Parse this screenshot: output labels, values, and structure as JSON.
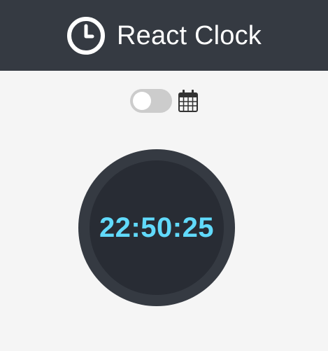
{
  "header": {
    "title": "React Clock",
    "icon": "clock-icon"
  },
  "controls": {
    "toggle_on": false,
    "calendar_icon": "calendar-icon"
  },
  "clock": {
    "time": "22:50:25"
  },
  "colors": {
    "header_bg": "#353a42",
    "page_bg": "#f5f5f5",
    "clock_ring": "#353a42",
    "clock_inner": "#282c34",
    "time_text": "#61dafb",
    "toggle_off": "#cccccc"
  }
}
